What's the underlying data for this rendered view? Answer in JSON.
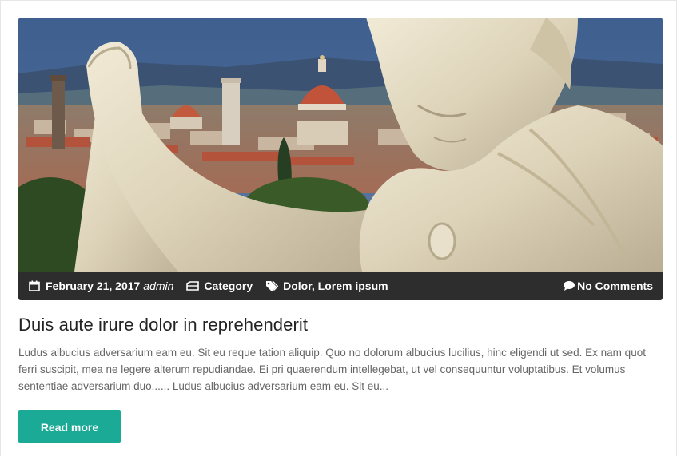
{
  "post": {
    "image_alt": "Statue overlooking Florence cathedral",
    "meta": {
      "date": "February 21, 2017",
      "author": "admin",
      "category": "Category",
      "tags": "Dolor, Lorem ipsum",
      "comments": "No Comments"
    },
    "title": "Duis aute irure dolor in reprehenderit",
    "excerpt": "Ludus albucius adversarium eam eu. Sit eu reque tation aliquip. Quo no dolorum albucius lucilius, hinc eligendi ut sed. Ex nam quot ferri suscipit, mea ne legere alterum repudiandae. Ei pri quaerendum intellegebat, ut vel consequuntur voluptatibus. Et volumus sententiae adversarium duo...... Ludus albucius adversarium eam eu. Sit eu...",
    "read_more_label": "Read more"
  },
  "colors": {
    "accent": "#1aaa96",
    "meta_bar": "#2d2d2d"
  },
  "icons": [
    "calendar-icon",
    "folder-icon",
    "tags-icon",
    "comment-icon"
  ]
}
